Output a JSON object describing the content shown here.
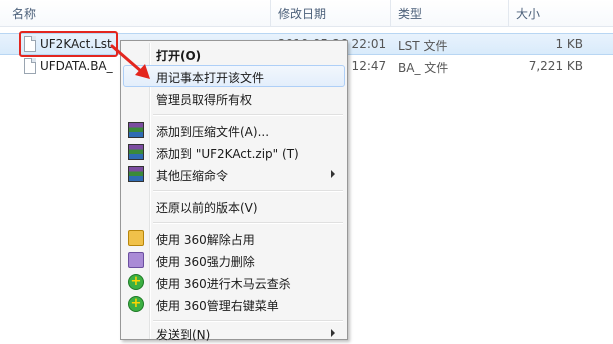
{
  "columns": {
    "name": "名称",
    "modified": "修改日期",
    "type": "类型",
    "size": "大小"
  },
  "files": [
    {
      "name": "UF2KAct.Lst",
      "modified": "2010-05-26 22:01",
      "type": "LST 文件",
      "size": "1 KB"
    },
    {
      "name": "UFDATA.BA_",
      "modified": "2010-05-26 12:47",
      "type": "BA_ 文件",
      "size": "7,221 KB"
    }
  ],
  "menu": {
    "open": "打开(O)",
    "open_notepad": "用记事本打开该文件",
    "take_ownership": "管理员取得所有权",
    "add_to_archive": "添加到压缩文件(A)...",
    "add_to_zip": "添加到 \"UF2KAct.zip\" (T)",
    "other_compress": "其他压缩命令",
    "restore_previous": "还原以前的版本(V)",
    "unlock_360": "使用 360解除占用",
    "force_delete_360": "使用 360强力删除",
    "trojan_scan_360": "使用 360进行木马云查杀",
    "manage_menu_360": "使用 360管理右键菜单",
    "send_to": "发送到(N)"
  },
  "colors": {
    "highlight_box": "#e3261f",
    "arrow": "#e3261f",
    "menu_bg": "#f5f5f5",
    "selection": "#d9ebfb"
  },
  "icons": {
    "archive": "winrar-icon",
    "unlock": "360-unlock-icon",
    "delete": "360-delete-icon",
    "scan": "360-plus-icon"
  }
}
